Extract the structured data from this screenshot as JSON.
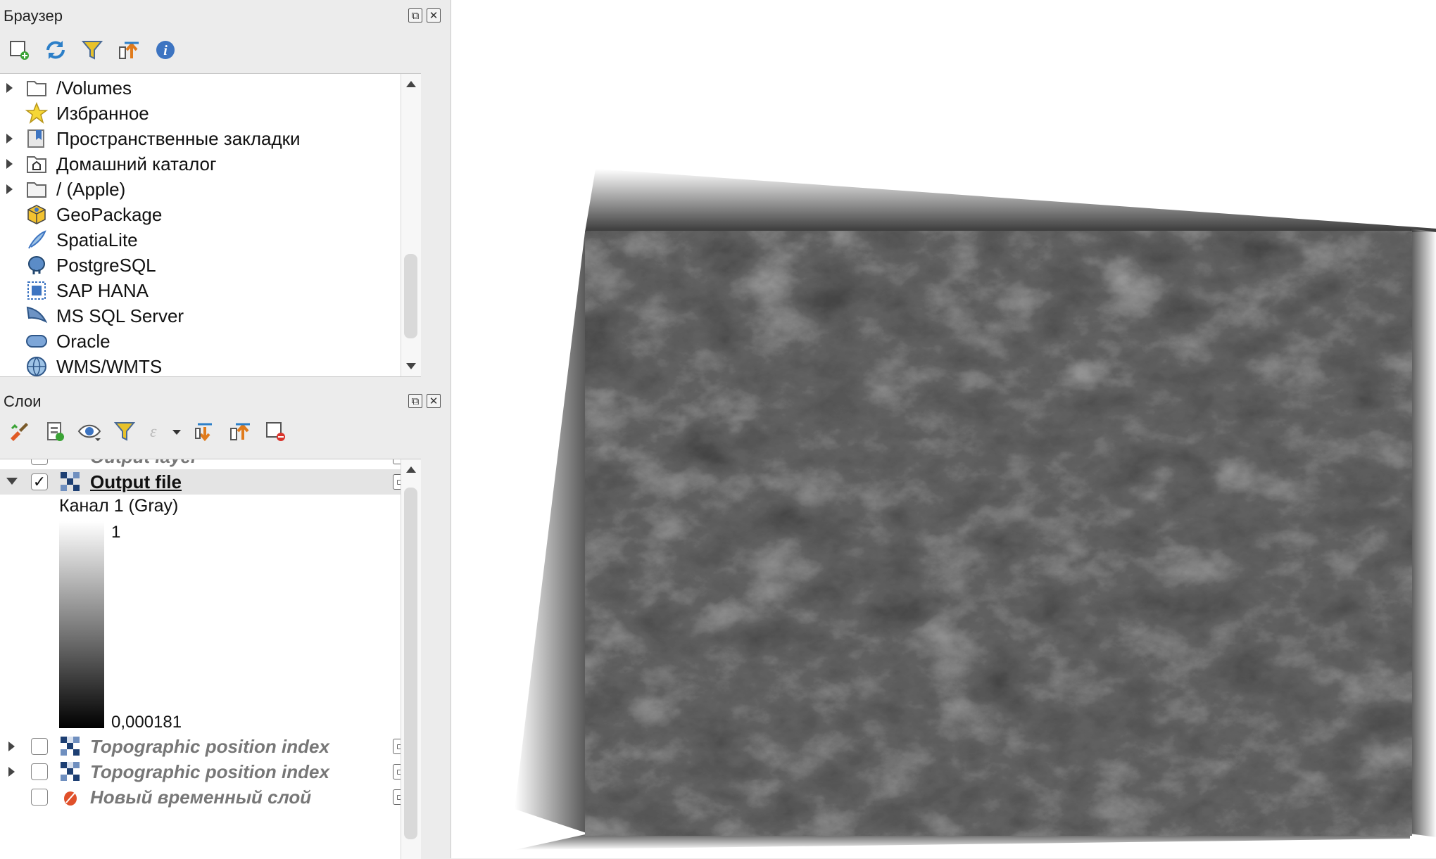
{
  "browser_panel": {
    "title": "Браузер",
    "toolbar": [
      "add-layer-icon",
      "refresh-icon",
      "filter-icon",
      "collapse-all-icon",
      "info-icon"
    ],
    "items": [
      {
        "label": "/Volumes",
        "icon": "folder-icon",
        "expandable": true
      },
      {
        "label": "Избранное",
        "icon": "star-icon",
        "expandable": false
      },
      {
        "label": "Пространственные закладки",
        "icon": "bookmark-icon",
        "expandable": true
      },
      {
        "label": "Домашний каталог",
        "icon": "home-folder-icon",
        "expandable": true
      },
      {
        "label": "/ (Apple)",
        "icon": "folder-icon",
        "expandable": true
      },
      {
        "label": "GeoPackage",
        "icon": "geopackage-icon",
        "expandable": false
      },
      {
        "label": "SpatiaLite",
        "icon": "spatialite-icon",
        "expandable": false
      },
      {
        "label": "PostgreSQL",
        "icon": "postgresql-icon",
        "expandable": false
      },
      {
        "label": "SAP HANA",
        "icon": "sap-hana-icon",
        "expandable": false
      },
      {
        "label": "MS SQL Server",
        "icon": "mssql-icon",
        "expandable": false
      },
      {
        "label": "Oracle",
        "icon": "oracle-icon",
        "expandable": false
      },
      {
        "label": "WMS/WMTS",
        "icon": "globe-icon",
        "expandable": false
      }
    ]
  },
  "layers_panel": {
    "title": "Слои",
    "toolbar": [
      "style-icon",
      "add-group-icon",
      "visibility-icon",
      "filter-icon",
      "expression-icon",
      "expand-all-icon",
      "collapse-all-icon",
      "remove-layer-icon"
    ],
    "cut_layer_label": "Output layer",
    "active_layer": {
      "label": "Output file",
      "checked": true
    },
    "legend": {
      "band": "Канал 1 (Gray)",
      "max": "1",
      "min": "0,000181"
    },
    "other_layers": [
      {
        "label": "Topographic position index",
        "checked": false
      },
      {
        "label": "Topographic position index",
        "checked": false
      },
      {
        "label": "Новый временный слой",
        "checked": false
      }
    ]
  },
  "colors": {
    "panel_bg": "#ececec",
    "tree_bg": "#ffffff",
    "canvas_bg": "#ffffff",
    "raster_dark": "#1e1e1e"
  }
}
